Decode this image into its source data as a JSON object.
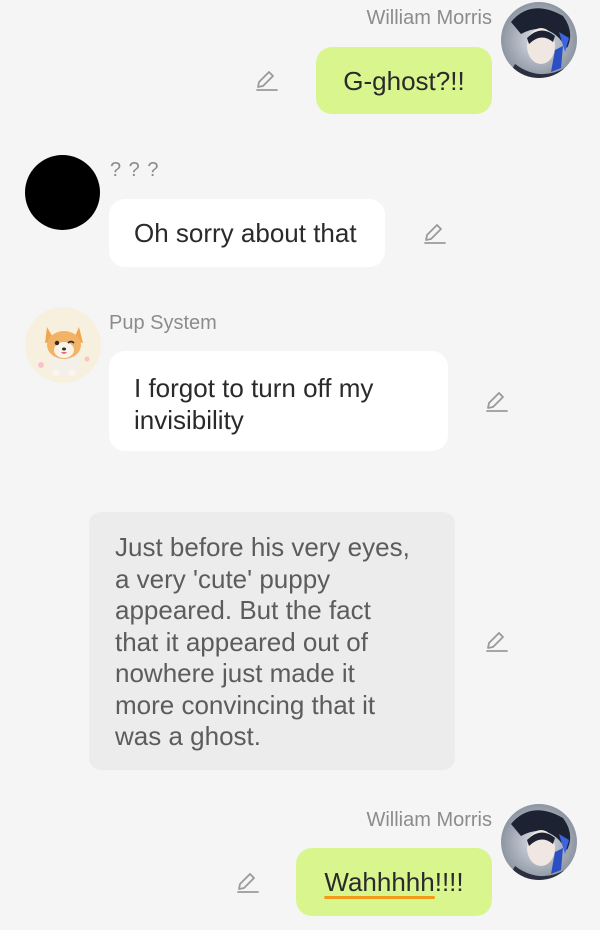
{
  "messages": [
    {
      "sender": "William Morris",
      "text": "G-ghost?!!"
    },
    {
      "sender": "? ? ?",
      "text": "Oh sorry about that"
    },
    {
      "sender": "Pup System",
      "text": "I forgot to turn off my invisibility"
    },
    {
      "text": "Just before his very eyes, a very 'cute' puppy appeared. But the fact that it appeared out of nowhere just made it more convincing that it was a ghost."
    },
    {
      "sender": "William Morris",
      "text_main": "Wahhhhh",
      "text_tail": "!!!!"
    }
  ],
  "icons": {
    "edit": "pencil-edit-icon"
  },
  "colors": {
    "background": "#f5f5f5",
    "outgoing_bubble": "#d9f58e",
    "incoming_bubble": "#ffffff",
    "narration_bubble": "#ececec",
    "sender_name": "#8c8c8c",
    "spellcheck_underline": "#f29a1a"
  }
}
